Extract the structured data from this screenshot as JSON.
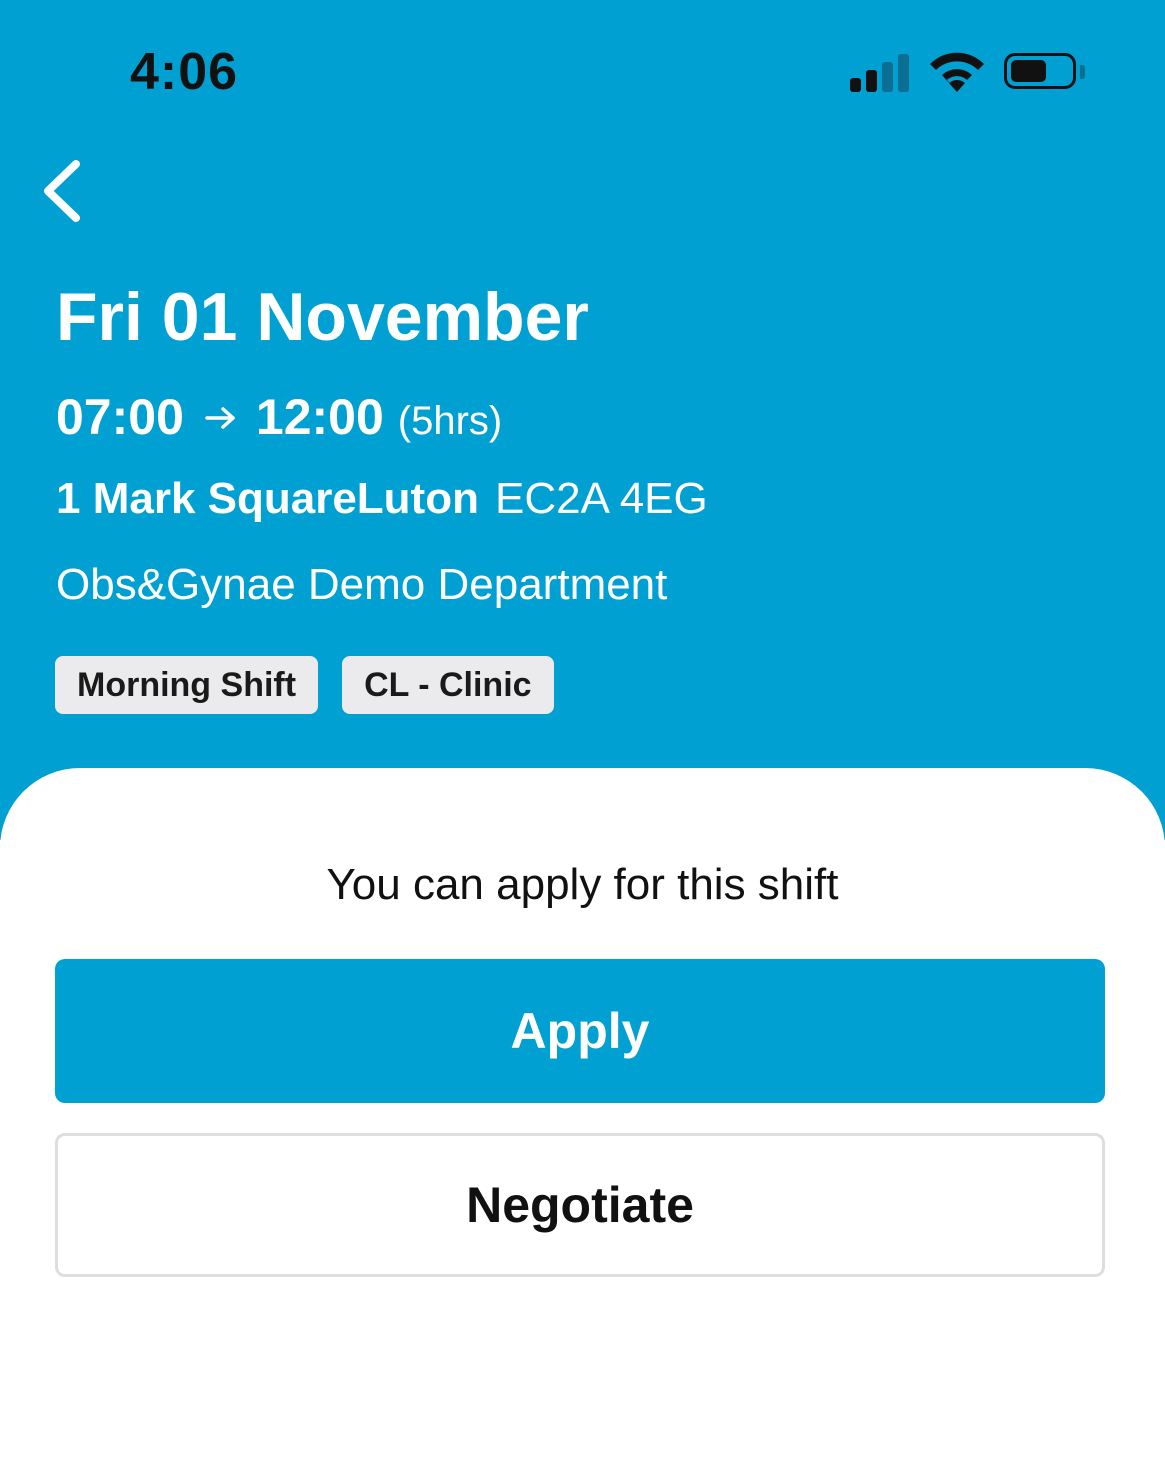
{
  "status_bar": {
    "time": "4:06",
    "signal_bars_active": 2,
    "signal_bars_total": 4,
    "battery_level": 0.6
  },
  "colors": {
    "primary": "#00A0D2",
    "tag_bg": "#EBEBED",
    "status_dark": "#111111",
    "signal_inactive": "#0B6F93"
  },
  "header": {
    "back_icon": "chevron-left-icon",
    "date": "Fri 01 November",
    "start_time": "07:00",
    "end_time": "12:00",
    "duration": "(5hrs)",
    "arrow_icon": "arrow-right-icon",
    "address_street": "1 Mark SquareLuton",
    "address_postcode": "EC2A 4EG",
    "department": "Obs&Gynae Demo Department",
    "tags": [
      "Morning Shift",
      "CL - Clinic"
    ]
  },
  "sheet": {
    "message": "You can apply for this shift",
    "apply_label": "Apply",
    "negotiate_label": "Negotiate"
  }
}
